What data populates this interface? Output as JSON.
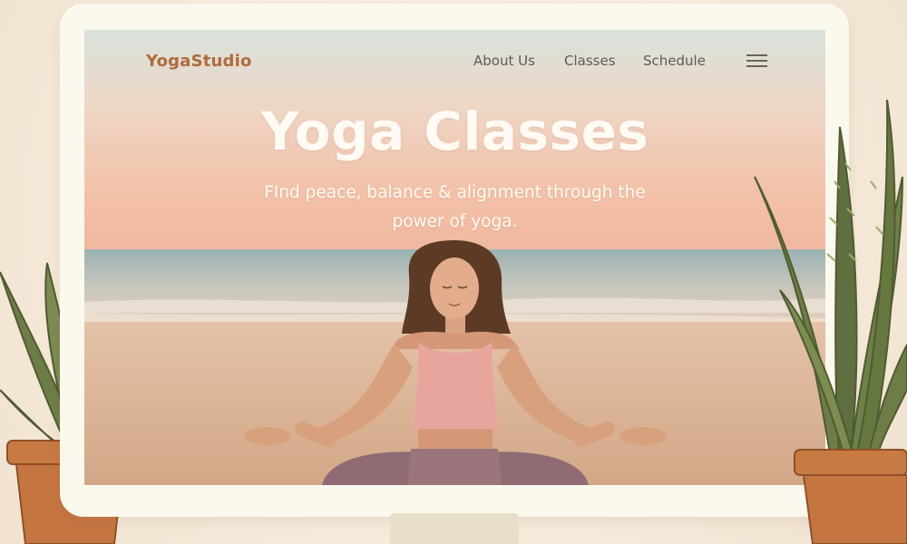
{
  "site": {
    "brand": "YogaStudio"
  },
  "nav": {
    "items": [
      {
        "label": "About Us"
      },
      {
        "label": "Classes"
      },
      {
        "label": "Schedule"
      }
    ],
    "menu_icon": "hamburger-menu-icon"
  },
  "hero": {
    "title": "Yoga Classes",
    "subtitle": "FInd peace, balance & alignment through the power of yoga."
  },
  "colors": {
    "brand": "#b06a3c",
    "nav_text": "#5f5a55",
    "hero_text": "#fffaf3",
    "frame": "#fbf8ee",
    "wall": "#f6eadb",
    "pot": "#c87a43",
    "leaf": "#6e7d48"
  }
}
